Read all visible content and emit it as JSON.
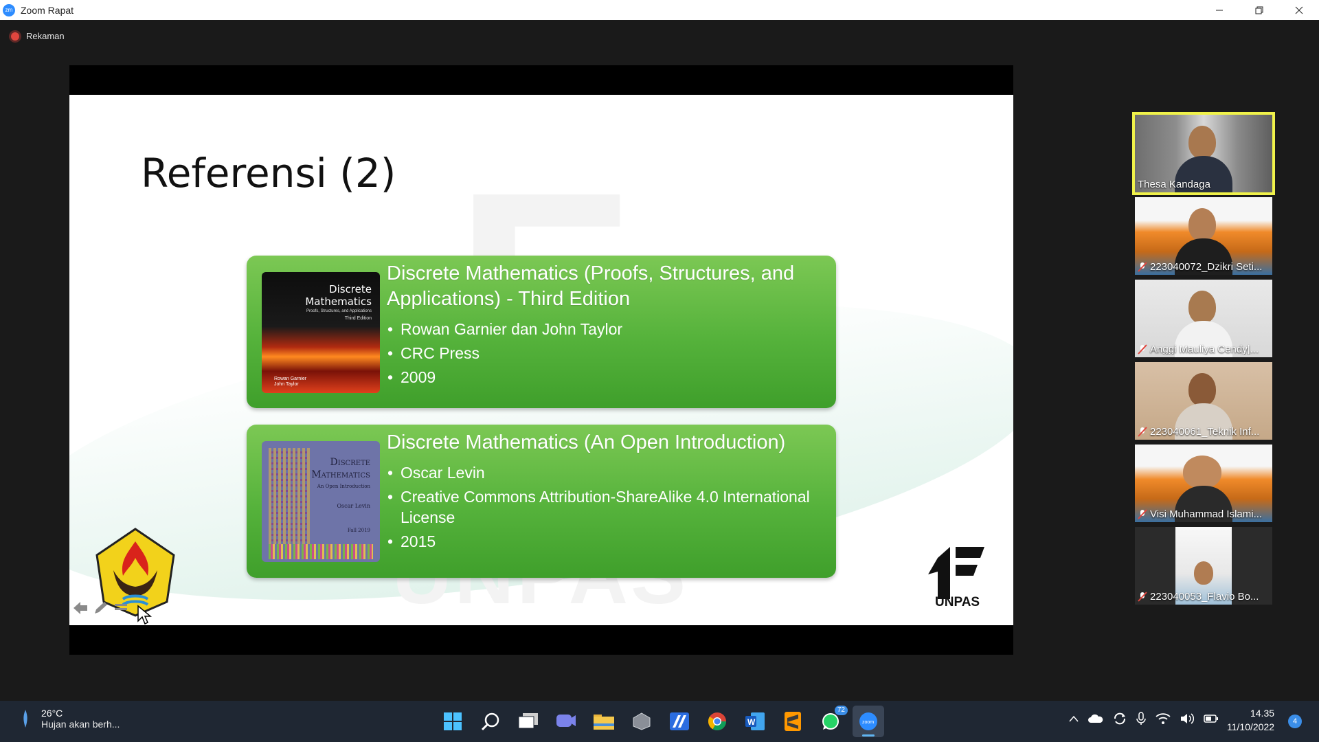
{
  "window": {
    "title": "Zoom Rapat",
    "controls": [
      "minimize",
      "restore",
      "close"
    ]
  },
  "recording": {
    "label": "Rekaman"
  },
  "slide": {
    "title": "Referensi (2)",
    "references": [
      {
        "title": "Discrete Mathematics (Proofs, Structures, and Applications) - Third Edition",
        "items": [
          "Rowan Garnier dan John Taylor",
          "CRC Press",
          "2009"
        ],
        "cover": {
          "title_line1": "Discrete",
          "title_line2": "Mathematics",
          "subtitle": "Proofs, Structures, and Applications",
          "edition": "Third Edition",
          "author1": "Rowan Garnier",
          "author2": "John Taylor"
        }
      },
      {
        "title": "Discrete Mathematics (An Open Introduction)",
        "items": [
          "Oscar Levin",
          "Creative Commons Attribution-ShareAlike 4.0 International License",
          "2015"
        ],
        "cover": {
          "title_line1": "Discrete",
          "title_line2": "Mathematics",
          "subtitle": "An Open Introduction",
          "author": "Oscar Levin",
          "year": "Fall 2019"
        }
      }
    ],
    "logo_text": "UNPAS",
    "watermark_text": "UNPAS"
  },
  "participants": [
    {
      "name": "Thesa Kandaga",
      "active": true,
      "muted": false
    },
    {
      "name": "223040072_Dzikri Seti...",
      "active": false,
      "muted": true
    },
    {
      "name": "Anggi Mauliya Cendy|...",
      "active": false,
      "muted": true
    },
    {
      "name": "223040061_Teknik Inf...",
      "active": false,
      "muted": true
    },
    {
      "name": "Visi Muhammad Islami...",
      "active": false,
      "muted": true
    },
    {
      "name": "223040053_Flavio Bo...",
      "active": false,
      "muted": true
    }
  ],
  "taskbar": {
    "weather_temp": "26°C",
    "weather_desc": "Hujan akan berh...",
    "apps": [
      "start-icon",
      "search-icon",
      "task-view-icon",
      "teams-chat-icon",
      "file-explorer-icon",
      "app-icon",
      "app-icon",
      "chrome-icon",
      "word-icon",
      "sublime-icon",
      "whatsapp-icon",
      "zoom-icon"
    ],
    "whatsapp_badge": "72",
    "time": "14.35",
    "date": "11/10/2022",
    "notification_count": "4"
  },
  "colors": {
    "card_green": "#55b23b",
    "active_border": "#f0f24a",
    "taskbar_bg": "#1f2733",
    "zoom_blue": "#2d8cff"
  }
}
